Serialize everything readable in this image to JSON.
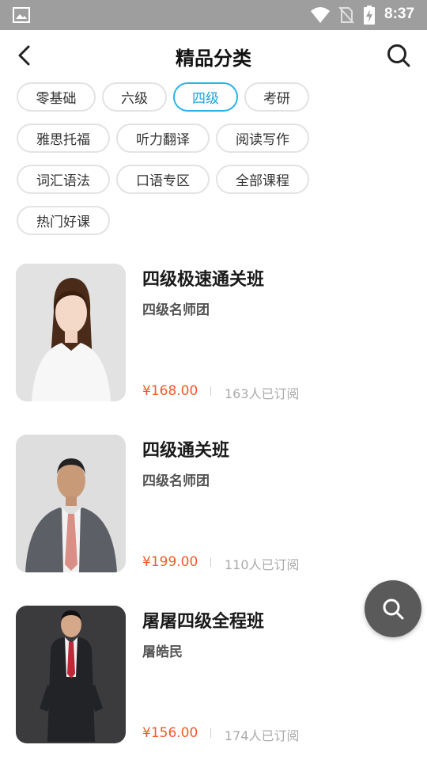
{
  "status_bar": {
    "time": "8:37",
    "icons": [
      "image-icon",
      "wifi-icon",
      "no-sim-icon",
      "battery-charging-icon"
    ]
  },
  "header": {
    "title": "精品分类",
    "back_icon": "back-icon",
    "search_icon": "search-icon"
  },
  "categories": [
    {
      "label": "零基础",
      "active": false
    },
    {
      "label": "六级",
      "active": false
    },
    {
      "label": "四级",
      "active": true
    },
    {
      "label": "考研",
      "active": false
    },
    {
      "label": "雅思托福",
      "active": false
    },
    {
      "label": "听力翻译",
      "active": false
    },
    {
      "label": "阅读写作",
      "active": false
    },
    {
      "label": "词汇语法",
      "active": false
    },
    {
      "label": "口语专区",
      "active": false
    },
    {
      "label": "全部课程",
      "active": false
    },
    {
      "label": "热门好课",
      "active": false
    }
  ],
  "courses": [
    {
      "title": "四级极速通关班",
      "teacher": "四级名师团",
      "price": "¥168.00",
      "subscribers": "163人已订阅"
    },
    {
      "title": "四级通关班",
      "teacher": "四级名师团",
      "price": "¥199.00",
      "subscribers": "110人已订阅"
    },
    {
      "title": "屠屠四级全程班",
      "teacher": "屠皓民",
      "price": "¥156.00",
      "subscribers": "174人已订阅"
    }
  ],
  "colors": {
    "accent": "#2cb4e8",
    "price": "#f05a28",
    "fab": "#5a5a5a"
  },
  "fab_icon": "search-icon"
}
